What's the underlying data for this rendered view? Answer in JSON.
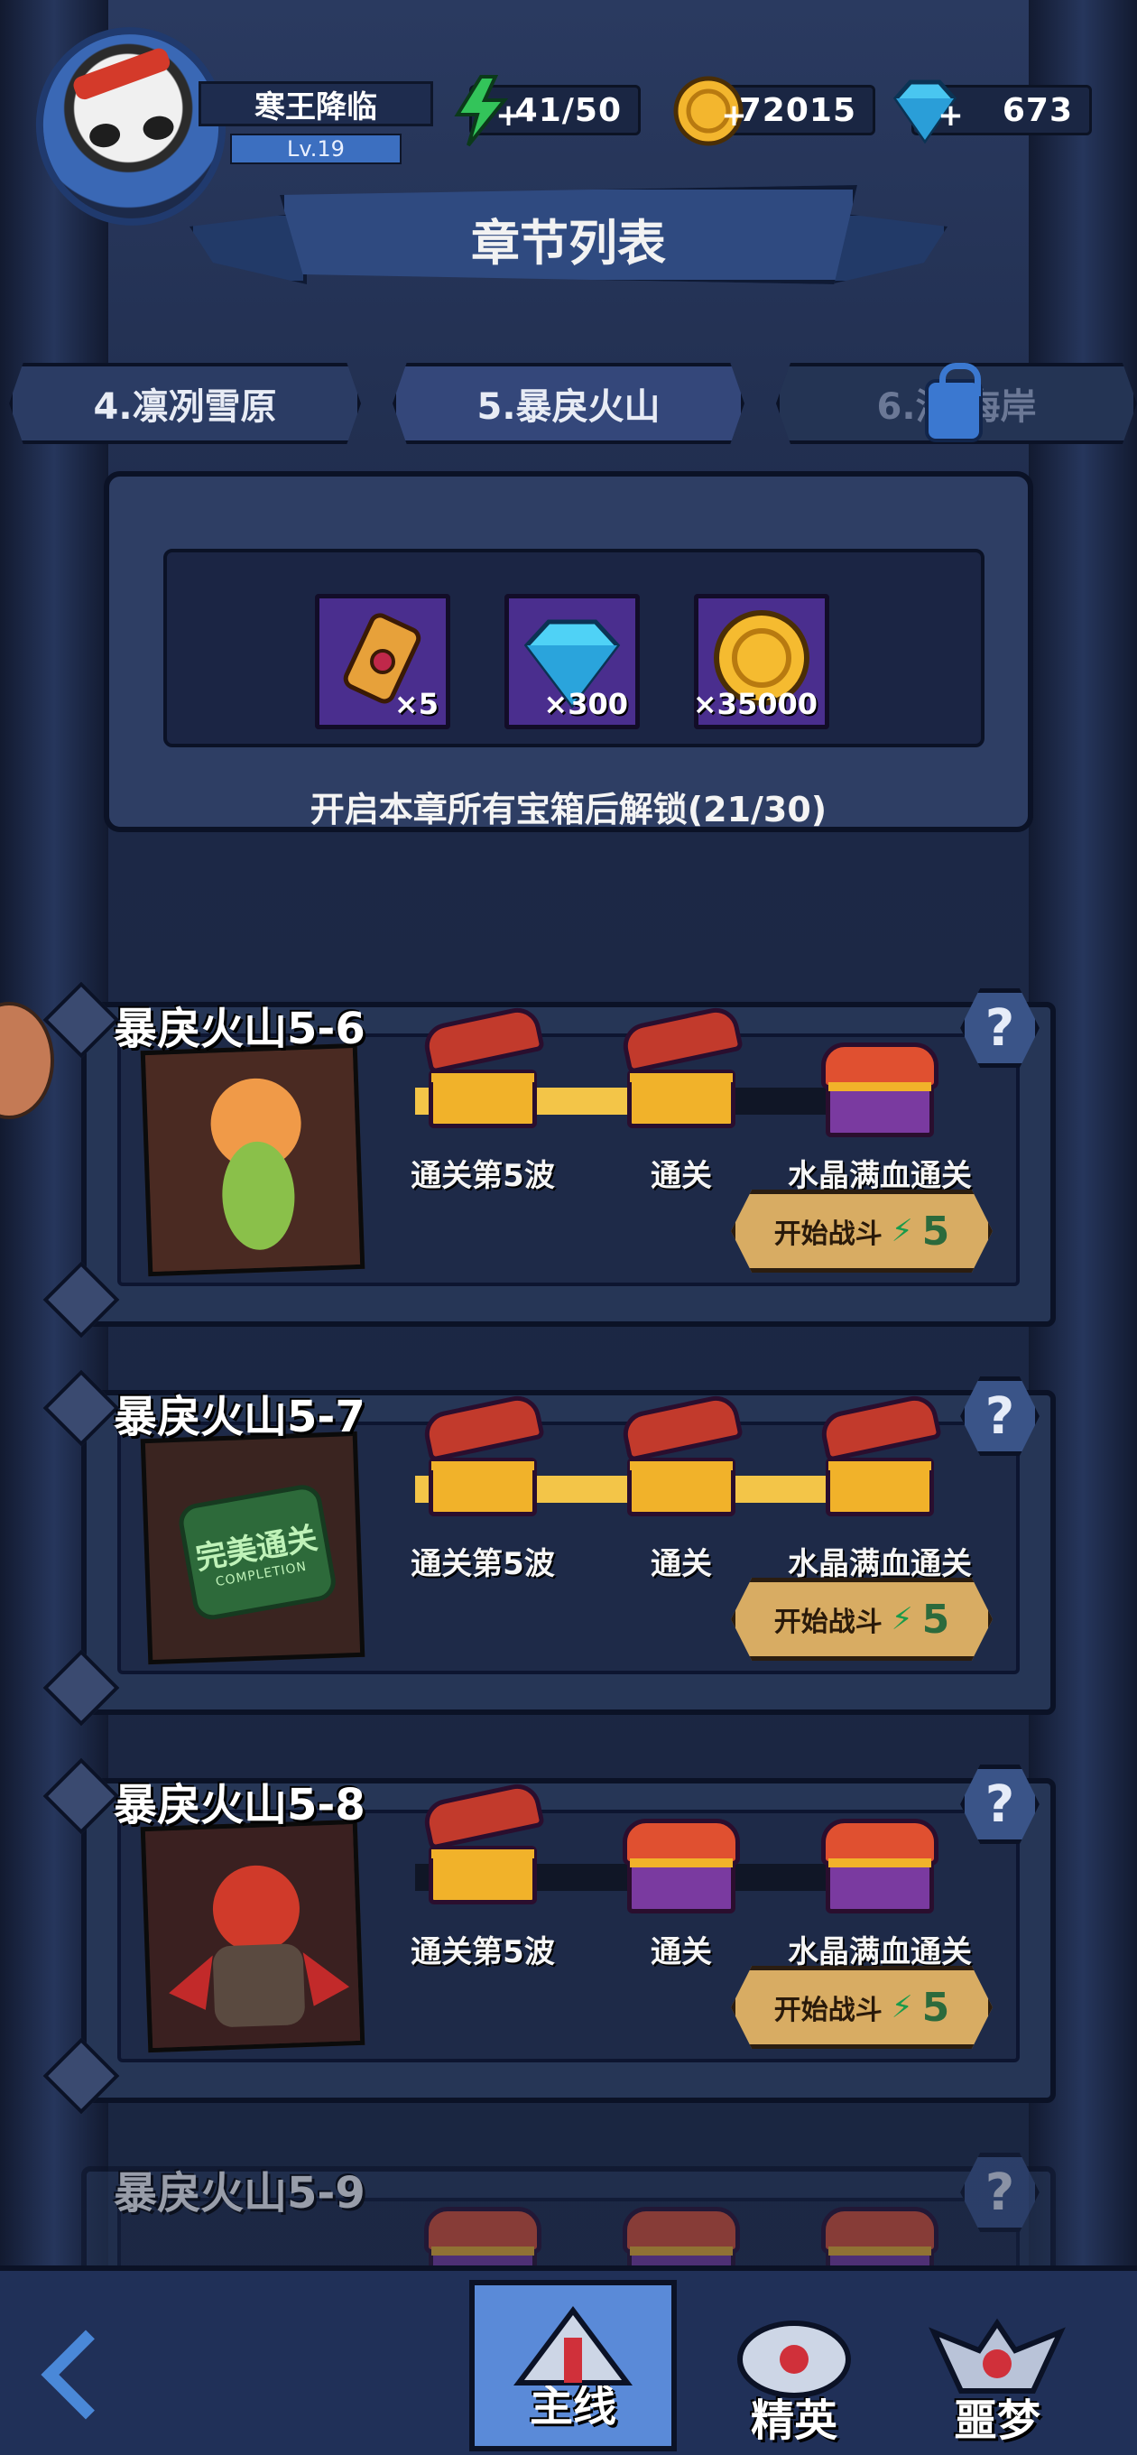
{
  "player": {
    "name": "寒王降临",
    "level": "Lv.19",
    "energy": "41/50",
    "gold": "572015",
    "gems": "673"
  },
  "header": {
    "title": "章节列表"
  },
  "chapter_tabs": [
    {
      "label": "4.凛冽雪原"
    },
    {
      "label": "5.暴戾火山"
    },
    {
      "label": "6.湮没海岸",
      "shown_text": "6.湮  海岸",
      "locked": true
    }
  ],
  "chapter_reward": {
    "items": [
      {
        "icon": "scroll-icon",
        "count": "×5"
      },
      {
        "icon": "diamond-icon",
        "count": "×300"
      },
      {
        "icon": "gold-coin-icon",
        "count": "×35000"
      }
    ],
    "unlock_text": "开启本章所有宝箱后解锁(21/30)"
  },
  "levels": [
    {
      "title": "暴戾火山5-6",
      "chests": [
        {
          "label": "通关第5波",
          "opened": true
        },
        {
          "label": "通关",
          "opened": true
        },
        {
          "label": "水晶满血通关",
          "opened": false
        }
      ],
      "progress": 0.5,
      "start_label": "开始战斗",
      "cost": "5",
      "completion_stamp": false
    },
    {
      "title": "暴戾火山5-7",
      "chests": [
        {
          "label": "通关第5波",
          "opened": true
        },
        {
          "label": "通关",
          "opened": true
        },
        {
          "label": "水晶满血通关",
          "opened": true
        }
      ],
      "progress": 1.0,
      "start_label": "开始战斗",
      "cost": "5",
      "completion_stamp": true,
      "stamp_text": "完美通关",
      "stamp_sub": "COMPLETION"
    },
    {
      "title": "暴戾火山5-8",
      "chests": [
        {
          "label": "通关第5波",
          "opened": true
        },
        {
          "label": "通关",
          "opened": false
        },
        {
          "label": "水晶满血通关",
          "opened": false
        }
      ],
      "progress": 0.0,
      "start_label": "开始战斗",
      "cost": "5",
      "completion_stamp": false
    },
    {
      "title": "暴戾火山5-9",
      "dimmed": true
    }
  ],
  "bottom_nav": [
    {
      "label": "主线",
      "active": true
    },
    {
      "label": "精英",
      "active": false
    },
    {
      "label": "噩梦",
      "active": false
    }
  ],
  "colors": {
    "accent_blue": "#3b78d0",
    "progress_gold": "#f3c548",
    "energy_green": "#1a9a4a",
    "start_button": "#d8ac63"
  }
}
